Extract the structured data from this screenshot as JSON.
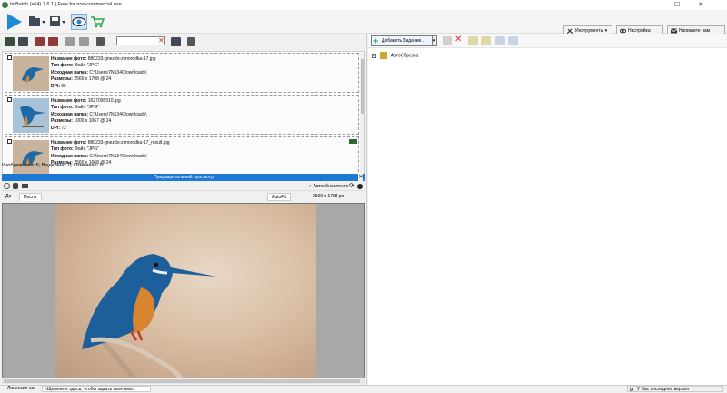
{
  "window": {
    "title": "ImBatch (x64) 7.6.1 | Free for non-commercial use",
    "minimize": "—",
    "maximize": "☐",
    "close": "✕"
  },
  "toolbar": {
    "tools_label": "Инструменты",
    "settings_label": "Настройка",
    "contact_label": "Напишите нам"
  },
  "left": {
    "search": {
      "value": "",
      "placeholder": ""
    },
    "images": [
      {
        "name_label": "Название фото:",
        "name_value": "880233-gnezdo-zimorodka-17.jpg",
        "type_label": "Тип фото:",
        "type_value": "Файл \"JPG\"",
        "folder_label": "Исходная папка:",
        "folder_value": "C:\\Users\\7N134\\Downloads\\",
        "size_label": "Размеры:",
        "size_value": "2560 x 1708 @ 24",
        "dpi_label": "DPI:",
        "dpi_value": "96"
      },
      {
        "name_label": "Название фото:",
        "name_value": "1627095910.jpg",
        "type_label": "Тип фото:",
        "type_value": "Файл \"JPG\"",
        "folder_label": "Исходная папка:",
        "folder_value": "C:\\Users\\7N134\\Downloads\\",
        "size_label": "Размеры:",
        "size_value": "1000 x 1067 @ 24",
        "dpi_label": "DPI:",
        "dpi_value": "72"
      },
      {
        "name_label": "Название фото:",
        "name_value": "880233-gnezdo-zimorodka-17_result.jpg",
        "type_label": "Тип фото:",
        "type_value": "Файл \"JPG\"",
        "folder_label": "Исходная папка:",
        "folder_value": "C:\\Users\\7N134\\Downloads\\",
        "size_label": "Размеры:",
        "size_value": "2560 x 1668 @ 24",
        "dpi_label": "",
        "dpi_value": ""
      }
    ],
    "status": "Изображений: 6; Выделено: 0; Отмечено: 0"
  },
  "preview": {
    "title": "Предварительный просмотр",
    "autoupdate_label": "✓ Автообновление",
    "tab_before": "До",
    "tab_after": "После",
    "autofit_label": "AutoFit",
    "dimensions": "2500 x 1708 px"
  },
  "right": {
    "add_task_label": "Добавить Задание...",
    "tree_root": "АвтоОбрезка"
  },
  "bottom": {
    "license_label": "Лицензия на:",
    "license_value": "<Щелкните здесь, чтобы задать свое имя>",
    "version_status": "У Вас последняя версия"
  },
  "colors": {
    "accent_blue": "#1c78d4",
    "play_blue": "#1e8ad6",
    "green_cart": "#2aa84a",
    "red_x": "#d83030"
  }
}
